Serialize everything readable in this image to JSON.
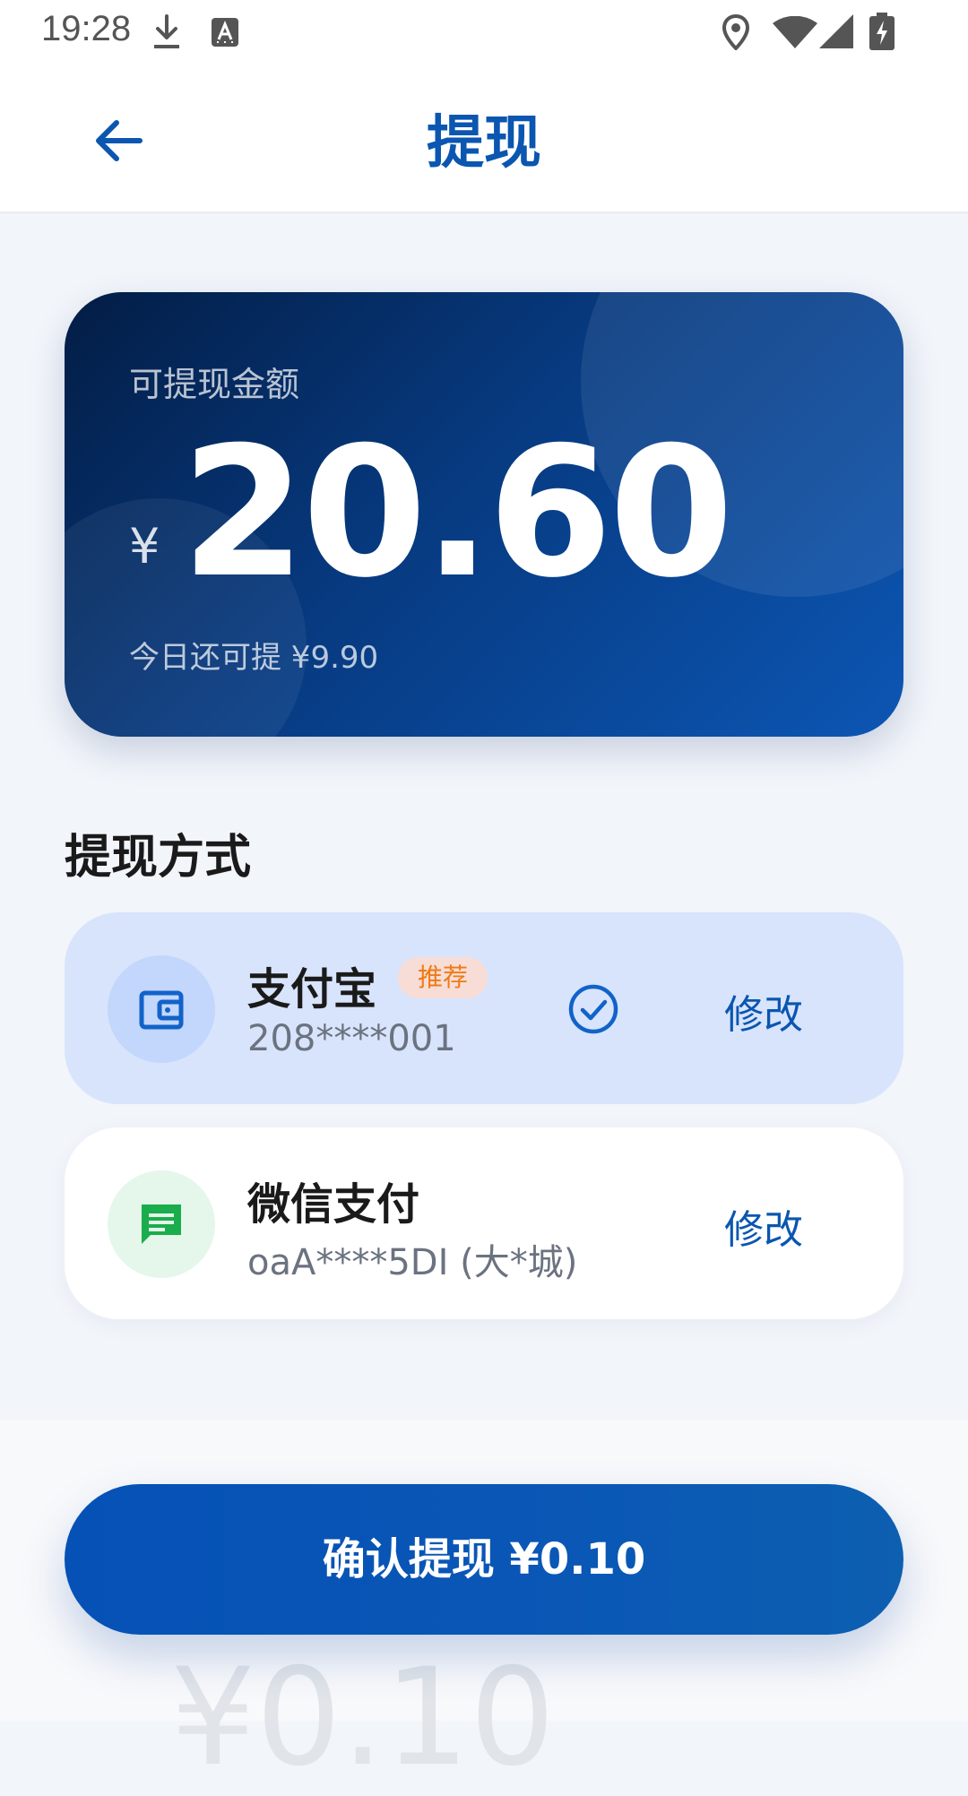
{
  "status_bar": {
    "time": "19:28",
    "icons": [
      "download-icon",
      "keyboard-a-icon",
      "location-icon",
      "wifi-icon",
      "signal-icon",
      "battery-charging-icon"
    ]
  },
  "app_bar": {
    "back_icon": "arrow-left-icon",
    "title": "提现"
  },
  "balance_card": {
    "label": "可提现金额",
    "currency": "¥",
    "amount": "20.60",
    "today_limit": "今日还可提 ¥9.90"
  },
  "methods_section": {
    "title": "提现方式",
    "methods": [
      {
        "name": "支付宝",
        "account": "208****001",
        "badge": "推荐",
        "selected": true,
        "edit_label": "修改",
        "icon": "wallet-icon"
      },
      {
        "name": "微信支付",
        "account": "oaA****5DI (大*城)",
        "selected": false,
        "edit_label": "修改",
        "icon": "chat-icon"
      }
    ]
  },
  "bottom": {
    "confirm_label": "确认提现 ¥0.10",
    "ghost_amount": "¥0.10"
  },
  "colors": {
    "primary": "#0a56b0",
    "accent_orange": "#f07a14",
    "wechat_green": "#1aad4c"
  }
}
